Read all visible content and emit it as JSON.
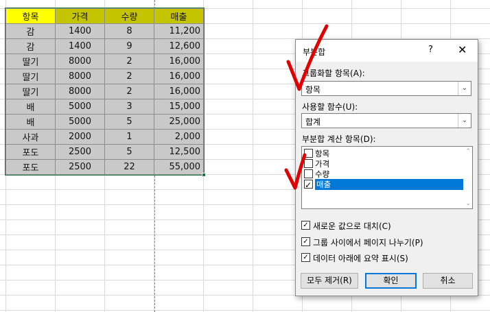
{
  "sheet": {
    "headers": [
      "항목",
      "가격",
      "수량",
      "매출"
    ],
    "rows": [
      [
        "감",
        "1400",
        "8",
        "11,200"
      ],
      [
        "감",
        "1400",
        "9",
        "12,600"
      ],
      [
        "딸기",
        "8000",
        "2",
        "16,000"
      ],
      [
        "딸기",
        "8000",
        "2",
        "16,000"
      ],
      [
        "딸기",
        "8000",
        "2",
        "16,000"
      ],
      [
        "배",
        "5000",
        "3",
        "15,000"
      ],
      [
        "배",
        "5000",
        "5",
        "25,000"
      ],
      [
        "사과",
        "2000",
        "1",
        "2,000"
      ],
      [
        "포도",
        "2500",
        "5",
        "12,500"
      ],
      [
        "포도",
        "2500",
        "22",
        "55,000"
      ]
    ]
  },
  "dialog": {
    "title": "부분합",
    "help": "?",
    "close": "✕",
    "group_by_label": "그룹화할 항목(A):",
    "group_by_value": "항목",
    "function_label": "사용할 함수(U):",
    "function_value": "합계",
    "add_to_label": "부분합 계산 항목(D):",
    "add_to_items": [
      {
        "label": "항목",
        "checked": false
      },
      {
        "label": "가격",
        "checked": false
      },
      {
        "label": "수량",
        "checked": false
      },
      {
        "label": "매출",
        "checked": true,
        "selected": true
      }
    ],
    "options": [
      {
        "label": "새로운 값으로 대치(C)",
        "checked": true
      },
      {
        "label": "그룹 사이에서 페이지 나누기(P)",
        "checked": true
      },
      {
        "label": "데이터 아래에 요약 표시(S)",
        "checked": true
      }
    ],
    "buttons": {
      "remove_all": "모두 제거(R)",
      "ok": "확인",
      "cancel": "취소"
    }
  },
  "colors": {
    "header_fill": "#ffff00",
    "cell_fill": "#c9c9c9",
    "selection": "#0078d7",
    "annotation": "#e00000"
  }
}
